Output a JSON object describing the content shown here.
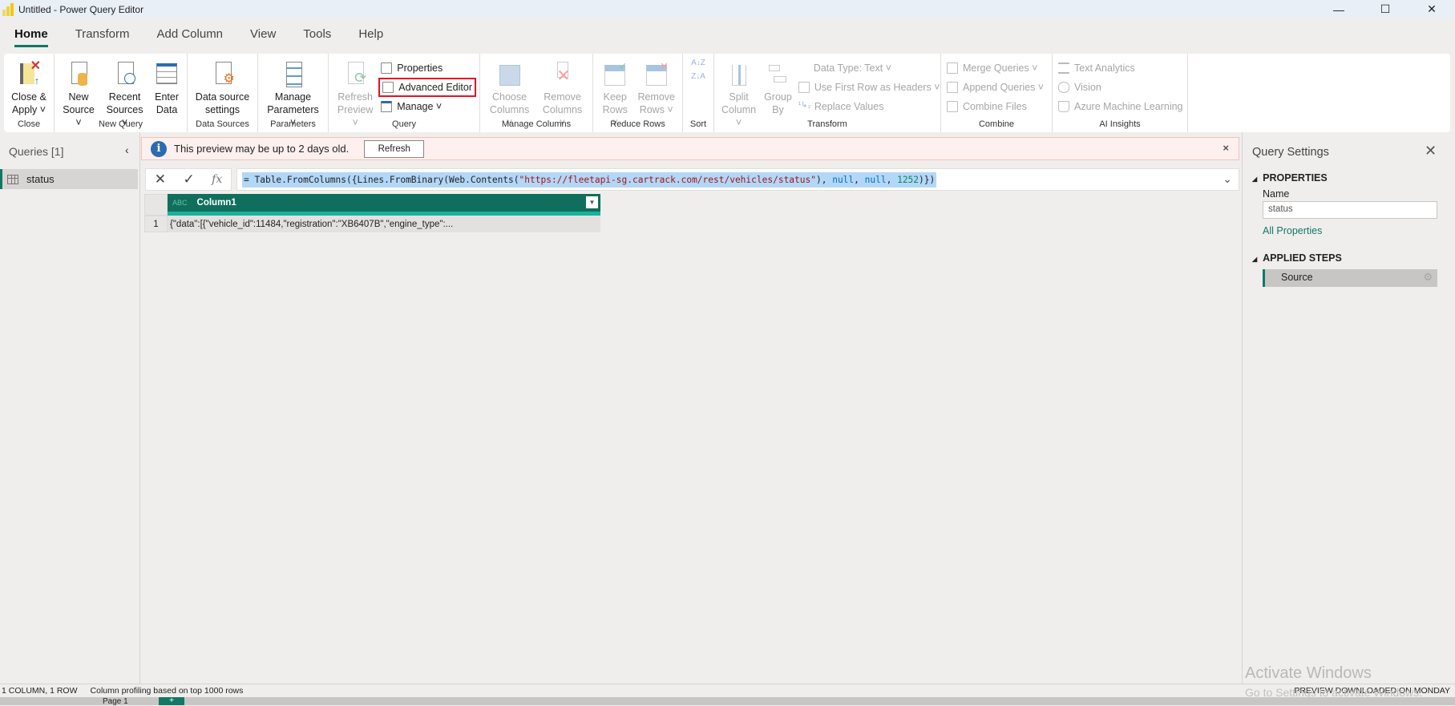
{
  "window": {
    "title": "Untitled - Power Query Editor",
    "controls": {
      "minimize": "—",
      "maximize": "☐",
      "close": "✕"
    }
  },
  "tabs": [
    {
      "label": "Home",
      "active": true
    },
    {
      "label": "Transform"
    },
    {
      "label": "Add Column"
    },
    {
      "label": "View"
    },
    {
      "label": "Tools"
    },
    {
      "label": "Help"
    }
  ],
  "ribbon": {
    "close": {
      "label": "Close",
      "close_apply": "Close & Apply ˅"
    },
    "new_query": {
      "label": "New Query",
      "new_source": "New Source ˅",
      "recent_sources": "Recent Sources ˅",
      "enter_data": "Enter Data"
    },
    "data_sources": {
      "label": "Data Sources",
      "settings": "Data source settings"
    },
    "parameters": {
      "label": "Parameters",
      "manage": "Manage Parameters ˅"
    },
    "query": {
      "label": "Query",
      "refresh_preview": "Refresh Preview ˅",
      "properties": "Properties",
      "advanced_editor": "Advanced Editor",
      "manage": "Manage ˅"
    },
    "manage_columns": {
      "label": "Manage Columns",
      "choose": "Choose Columns ˅",
      "remove": "Remove Columns ˅"
    },
    "reduce_rows": {
      "label": "Reduce Rows",
      "keep": "Keep Rows ˅",
      "remove": "Remove Rows ˅"
    },
    "sort": {
      "label": "Sort",
      "asc": "A↓Z",
      "desc": "Z↓A"
    },
    "transform": {
      "label": "Transform",
      "split": "Split Column ˅",
      "group": "Group By",
      "data_type": "Data Type: Text ˅",
      "first_row": "Use First Row as Headers ˅",
      "replace": "Replace Values"
    },
    "combine": {
      "label": "Combine",
      "merge": "Merge Queries ˅",
      "append": "Append Queries ˅",
      "files": "Combine Files"
    },
    "ai": {
      "label": "AI Insights",
      "text": "Text Analytics",
      "vision": "Vision",
      "aml": "Azure Machine Learning"
    }
  },
  "queries": {
    "header": "Queries [1]",
    "collapse": "‹",
    "items": [
      {
        "label": "status"
      }
    ]
  },
  "notice": {
    "message": "This preview may be up to 2 days old.",
    "refresh": "Refresh",
    "close": "×"
  },
  "formula": {
    "cancel": "✕",
    "commit": "✓",
    "fx": "fx",
    "eq": "= ",
    "p1": "Table.FromColumns({Lines.FromBinary(Web.Contents(",
    "url": "\"https://fleetapi-sg.cartrack.com/rest/vehicles/status\"",
    "p2": "), ",
    "null1": "null",
    "p3": ", ",
    "null2": "null",
    "p4": ", ",
    "num": "1252",
    "p5": ")})",
    "expand": "⌄"
  },
  "grid": {
    "column": "Column1",
    "type_icon": "ABC",
    "rows": [
      {
        "num": "1",
        "value": "{\"data\":[{\"vehicle_id\":11484,\"registration\":\"XB6407B\",\"engine_type\":..."
      }
    ]
  },
  "settings": {
    "title": "Query Settings",
    "close": "✕",
    "properties": "PROPERTIES",
    "name_label": "Name",
    "name_value": "status",
    "all_properties": "All Properties",
    "applied_steps": "APPLIED STEPS",
    "steps": [
      {
        "label": "Source"
      }
    ]
  },
  "status": {
    "left1": "1 COLUMN, 1 ROW",
    "left2": "Column profiling based on top 1000 rows",
    "right": "PREVIEW DOWNLOADED ON MONDAY"
  },
  "watermark": {
    "line1": "Activate Windows",
    "line2": "Go to Settings to activate Windows."
  },
  "pages": {
    "page": "Page 1",
    "add": "+"
  },
  "colors": {
    "accent": "#117865",
    "highlight": "#e81123"
  }
}
